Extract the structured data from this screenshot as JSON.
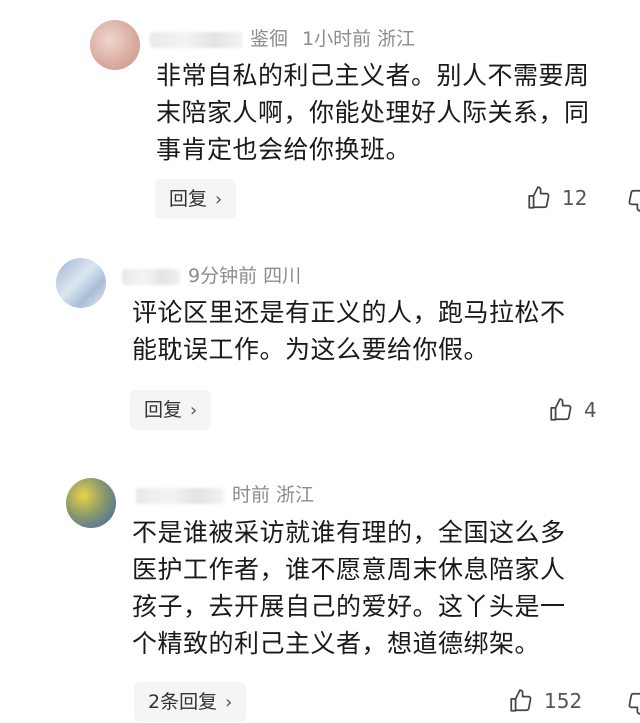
{
  "comments": [
    {
      "meta": "1小时前   浙江",
      "name_fragment": "鉴徊",
      "lines": [
        "非常自私的利己主义者。别人不需要周",
        "末陪家人啊，你能处理好人际关系，同",
        "事肯定也会给你换班。"
      ],
      "reply_label": "回复",
      "likes": "12"
    },
    {
      "meta": "9分钟前   四川",
      "name_fragment": "",
      "lines": [
        "评论区里还是有正义的人，跑马拉松不",
        "能耽误工作。为这么要给你假。"
      ],
      "reply_label": "回复",
      "likes": "4"
    },
    {
      "meta": "时前   浙江",
      "name_fragment": "",
      "lines": [
        "不是谁被采访就谁有理的，全国这么多",
        "医护工作者，谁不愿意周末休息陪家人",
        "孩子，去开展自己的爱好。这丫头是一",
        "个精致的利己主义者，想道德绑架。"
      ],
      "reply_label": "2条回复",
      "likes": "152"
    }
  ],
  "icons": {
    "like": "thumbs-up-icon",
    "reply_chevron": "chevron-right-icon"
  },
  "colors": {
    "meta": "#8c8c8c",
    "text": "#1a1a1a",
    "reply_bg": "#f5f5f5"
  }
}
